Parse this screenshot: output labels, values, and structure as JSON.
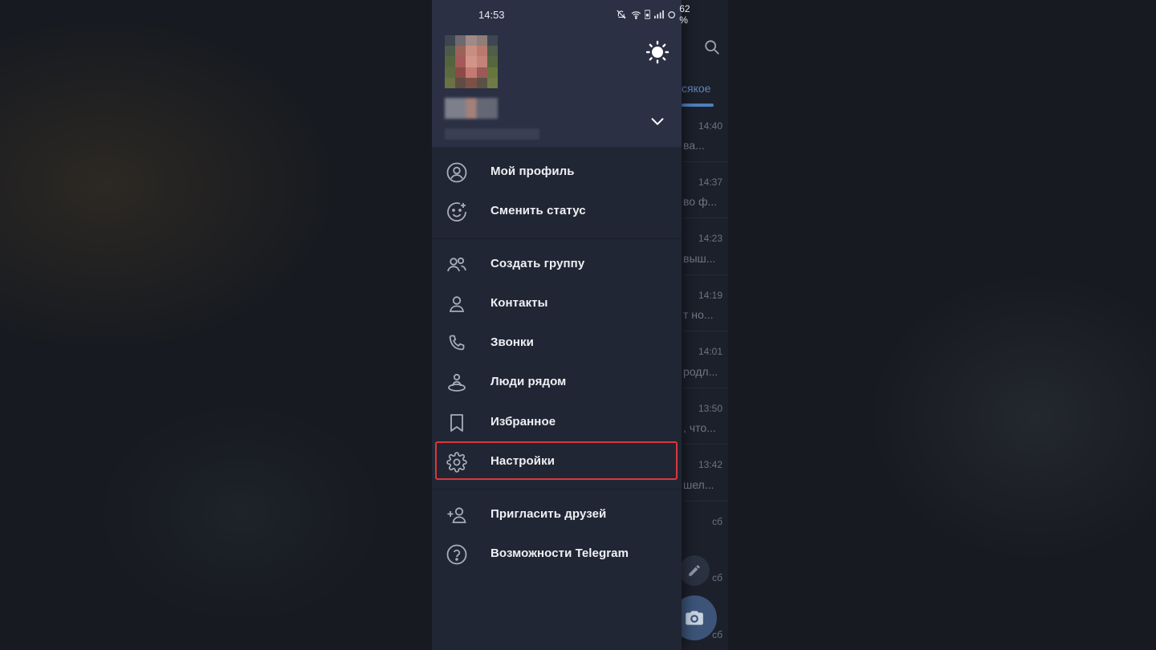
{
  "status_bar": {
    "time": "14:53",
    "battery": "62 %"
  },
  "chat_list": {
    "tab_label": "сякое",
    "rows": [
      {
        "time": "14:40",
        "preview": "ва..."
      },
      {
        "time": "14:37",
        "preview": "во ф..."
      },
      {
        "time": "14:23",
        "preview": "выш..."
      },
      {
        "time": "14:19",
        "preview": "т но..."
      },
      {
        "time": "14:01",
        "preview": "родл..."
      },
      {
        "time": "13:50",
        "preview": ", что..."
      },
      {
        "time": "13:42",
        "preview": "шел..."
      },
      {
        "time": "сб",
        "preview": ""
      },
      {
        "time": "сб",
        "preview": ""
      },
      {
        "time": "сб",
        "preview": ""
      }
    ]
  },
  "drawer": {
    "menu": [
      {
        "label": "Мой профиль",
        "icon": "profile-icon"
      },
      {
        "label": "Сменить статус",
        "icon": "smile-status-icon"
      },
      {
        "label": "Создать группу",
        "icon": "group-icon"
      },
      {
        "label": "Контакты",
        "icon": "contact-icon"
      },
      {
        "label": "Звонки",
        "icon": "phone-icon"
      },
      {
        "label": "Люди рядом",
        "icon": "nearby-people-icon"
      },
      {
        "label": "Избранное",
        "icon": "bookmark-icon"
      },
      {
        "label": "Настройки",
        "icon": "gear-icon"
      },
      {
        "label": "Пригласить друзей",
        "icon": "add-user-icon"
      },
      {
        "label": "Возможности Telegram",
        "icon": "help-icon"
      }
    ],
    "highlighted_item": "Настройки",
    "highlight_color": "#d9383d"
  }
}
